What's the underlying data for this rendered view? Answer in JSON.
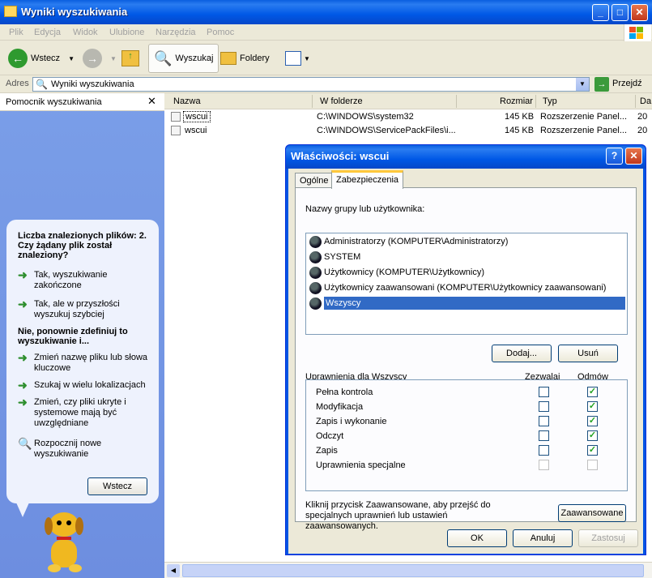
{
  "window": {
    "title": "Wyniki wyszukiwania"
  },
  "menu": [
    "Plik",
    "Edycja",
    "Widok",
    "Ulubione",
    "Narzędzia",
    "Pomoc"
  ],
  "toolbar": {
    "back": "Wstecz",
    "search": "Wyszukaj",
    "folders": "Foldery"
  },
  "address": {
    "label": "Adres",
    "value": "Wyniki wyszukiwania",
    "go": "Przejdź"
  },
  "sidebar": {
    "title": "Pomocnik wyszukiwania",
    "question": "Liczba znalezionych plików: 2. Czy żądany plik został znaleziony?",
    "opt1": "Tak, wyszukiwanie zakończone",
    "opt2": "Tak, ale w przyszłości wyszukuj szybciej",
    "question2": "Nie, ponownie zdefiniuj to wyszukiwanie i...",
    "opt3": "Zmień nazwę pliku lub słowa kluczowe",
    "opt4": "Szukaj w wielu lokalizacjach",
    "opt5": "Zmień, czy pliki ukryte i systemowe mają być uwzględniane",
    "opt6": "Rozpocznij nowe wyszukiwanie",
    "back": "Wstecz"
  },
  "columns": {
    "name": "Nazwa",
    "folder": "W folderze",
    "size": "Rozmiar",
    "type": "Typ",
    "date": "Da"
  },
  "files": [
    {
      "name": "wscui",
      "folder": "C:\\WINDOWS\\system32",
      "size": "145 KB",
      "type": "Rozszerzenie Panel...",
      "date": "20"
    },
    {
      "name": "wscui",
      "folder": "C:\\WINDOWS\\ServicePackFiles\\i...",
      "size": "145 KB",
      "type": "Rozszerzenie Panel...",
      "date": "20"
    }
  ],
  "dialog": {
    "title": "Właściwości: wscui",
    "help": "?",
    "tabs": [
      "Ogólne",
      "Zabezpieczenia"
    ],
    "groups_label": "Nazwy grupy lub użytkownika:",
    "users": [
      "Administratorzy (KOMPUTER\\Administratorzy)",
      "SYSTEM",
      "Użytkownicy (KOMPUTER\\Użytkownicy)",
      "Użytkownicy zaawansowani (KOMPUTER\\Użytkownicy zaawansowani)",
      "Wszyscy"
    ],
    "add": "Dodaj...",
    "remove": "Usuń",
    "perm_label": "Uprawnienia dla Wszyscy",
    "allow": "Zezwalaj",
    "deny": "Odmów",
    "perms": [
      "Pełna kontrola",
      "Modyfikacja",
      "Zapis i wykonanie",
      "Odczyt",
      "Zapis",
      "Uprawnienia specjalne"
    ],
    "deny_checked": [
      true,
      true,
      true,
      true,
      true,
      false
    ],
    "advanced_text": "Kliknij przycisk Zaawansowane, aby przejść do specjalnych uprawnień lub ustawień zaawansowanych.",
    "advanced": "Zaawansowane",
    "ok": "OK",
    "cancel": "Anuluj",
    "apply": "Zastosuj"
  }
}
